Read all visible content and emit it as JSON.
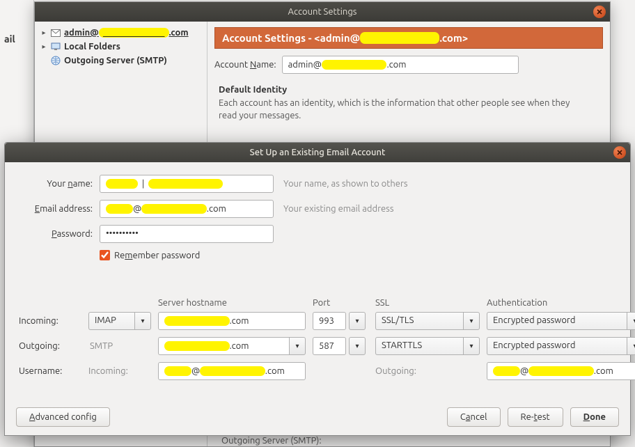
{
  "bgWindow": {
    "title": "Account Settings",
    "tree": {
      "accountLabelPrefix": "admin@",
      "accountLabelSuffix": ".com",
      "localFolders": "Local Folders",
      "outgoing": "Outgoing Server (SMTP)"
    },
    "headerPrefix": "Account Settings - <admin@",
    "headerSuffix": ".com>",
    "accountNameLabel": "Account Name:",
    "accountNameLabelAccess": "N",
    "accountNameValuePrefix": "admin@",
    "accountNameValueSuffix": ".com",
    "identityTitle": "Default Identity",
    "identityDesc": "Each account has an identity, which is the information that other people see when they read your messages.",
    "bottomPeek": "Outgoing Server (SMTP):"
  },
  "fgWindow": {
    "title": "Set Up an Existing Email Account",
    "labels": {
      "yourName": "Your name:",
      "yourNameAccess": "n",
      "email": "Email address:",
      "emailAccess": "E",
      "password": "Password:",
      "passwordAccess": "P",
      "remember": "Remember password",
      "rememberAccess": "m"
    },
    "hints": {
      "name": "Your name, as shown to others",
      "email": "Your existing email address"
    },
    "values": {
      "yourName": "██████ | ███████████",
      "email": "█████@███████████.com",
      "password": "••••••••••",
      "rememberChecked": true
    },
    "server": {
      "head": {
        "hostname": "Server hostname",
        "port": "Port",
        "ssl": "SSL",
        "auth": "Authentication"
      },
      "incomingLabel": "Incoming:",
      "outgoingLabel": "Outgoing:",
      "usernameLabel": "Username:",
      "incoming": {
        "protocol": "IMAP",
        "hostPrefix": "",
        "hostSuffix": ".com",
        "port": "993",
        "ssl": "SSL/TLS",
        "auth": "Encrypted password"
      },
      "outgoing": {
        "protocol": "SMTP",
        "hostPrefix": "",
        "hostSuffix": ".com",
        "port": "587",
        "ssl": "STARTTLS",
        "auth": "Encrypted password"
      },
      "username": {
        "incomingLabel": "Incoming:",
        "incomingPrefix": "",
        "incomingSuffix": ".com",
        "outgoingLabel": "Outgoing:",
        "outgoingPrefix": "",
        "outgoingSuffix": ".com"
      }
    },
    "buttons": {
      "advanced": "Advanced config",
      "advancedAccess": "A",
      "cancel": "Cancel",
      "cancelAccess": "a",
      "retest": "Re-test",
      "retestAccess": "t",
      "done": "Done",
      "doneAccess": "D"
    }
  },
  "leftStrip": {
    "item1": "ail "
  }
}
